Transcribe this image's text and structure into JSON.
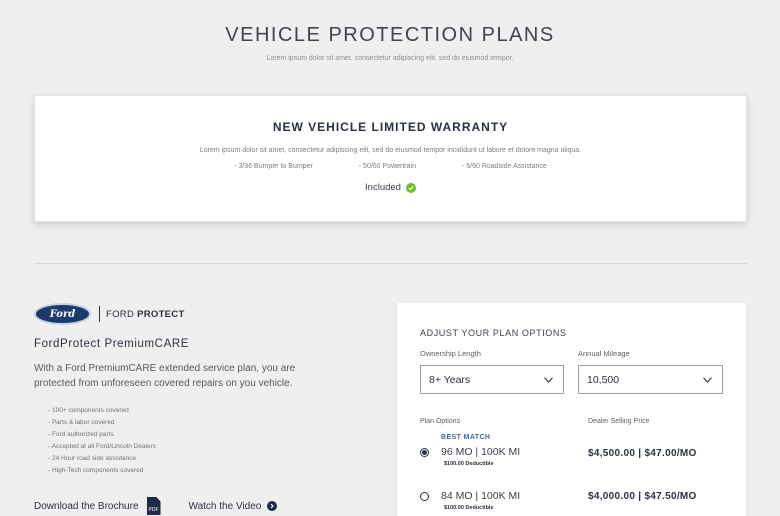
{
  "header": {
    "title": "VEHICLE PROTECTION PLANS",
    "subtitle": "Lorem ipsum dolor sit amet, consectetur adipiscing elit, sed do eiusmod tempor."
  },
  "warranty": {
    "title": "NEW VEHICLE LIMITED WARRANTY",
    "description": "Lorem ipsum dolor sit amet, consectetur adipiscing elit, sed do eiusmod tempor incididunt ut labore et dolore magna aliqua.",
    "features": [
      "- 3/36 Bumper to Bumper",
      "- 50/60 Powertrain",
      "- 5/60 Roadside Assistance"
    ],
    "status": "Included",
    "status_color": "#6bbf2a"
  },
  "brand": {
    "logo_text": "Ford",
    "name_prefix": "FORD",
    "name_bold": "PROTECT"
  },
  "plan": {
    "name": "FordProtect PremiumCARE",
    "description": "With a Ford PremiumCARE extended service plan, you are protected from unforeseen covered repairs on you vehicle.",
    "benefits": [
      "- 100+ components covered",
      "- Parts & labor covered",
      "- Ford authorized parts",
      "- Accepted at all Ford/Lincoln Dealers",
      "- 24 Hour road side assistance",
      "- High-Tech components covered"
    ],
    "brochure_label": "Download the Brochure",
    "pdf_label": "PDF",
    "video_label": "Watch the Video"
  },
  "options": {
    "title": "ADJUST YOUR PLAN OPTIONS",
    "ownership_label": "Ownership Length",
    "ownership_value": "8+ Years",
    "mileage_label": "Annual Mileage",
    "mileage_value": "10,500",
    "plan_options_label": "Plan Options",
    "price_label": "Dealer Selling Price",
    "plans": [
      {
        "badge": "BEST MATCH",
        "term": "96 MO | 100K MI",
        "deductible": "$100.00 Deductible",
        "price": "$4,500.00 | $47.00/MO",
        "selected": true
      },
      {
        "badge": "",
        "term": "84 MO | 100K MI",
        "deductible": "$100.00 Deductible",
        "price": "$4,000.00 | $47.50/MO",
        "selected": false
      }
    ],
    "accent_color": "#3b6aa8"
  }
}
